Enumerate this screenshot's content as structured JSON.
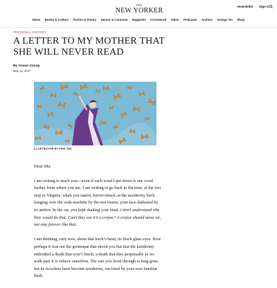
{
  "masthead": {
    "logo_small": "THE",
    "logo_main": "NEW YORKER",
    "newsletter": "Newsletter",
    "sign_in": "Sign In"
  },
  "nav": [
    "News",
    "Books & Culture",
    "Fiction & Poetry",
    "Humor & Cartoons",
    "Magazine",
    "Crossword",
    "Video",
    "Podcasts",
    "Archive",
    "Goings On",
    "Shop"
  ],
  "article": {
    "rubric": "PERSONAL HISTORY",
    "title": "A Letter to My Mother That She Will Never Read",
    "byline_prefix": "By ",
    "author": "Ocean Vuong",
    "date": "May 13, 2017",
    "illustration_credit": "ILLUSTRATION BY PING ZHU",
    "salutation": "Dear Ma,",
    "para1": "I am writing to reach you—even if each word I put down is one word further from where you are. I am writing to go back to the time, at the rest stop in Virginia, when you stared, horror-struck, at the taxidermy buck hanging over the soda machine by the rest rooms, your face darkened by its antlers. In the car, you kept shaking your head. ",
    "para1_italic": "I don’t understand why they would do that. Can’t they see it’s a corpse? A corpse should move on, not stay forever like that.",
    "para2": "I am thinking, only now, about that buck’s head, its black glass eyes. How perhaps it was not the grotesque that shook you but that the taxidermy embodied a death that won’t finish, a death that dies perpetually as we walk past it to relieve ourselves. The war you lived through is long gone, but its ricochets have become taxidermy, enclosed by your own familiar flesh."
  },
  "colors": {
    "rubric": "#d0202e",
    "sky": "#7cbad6",
    "butterfly": "#e08a2e",
    "figure_dress": "#6a3a8a"
  }
}
